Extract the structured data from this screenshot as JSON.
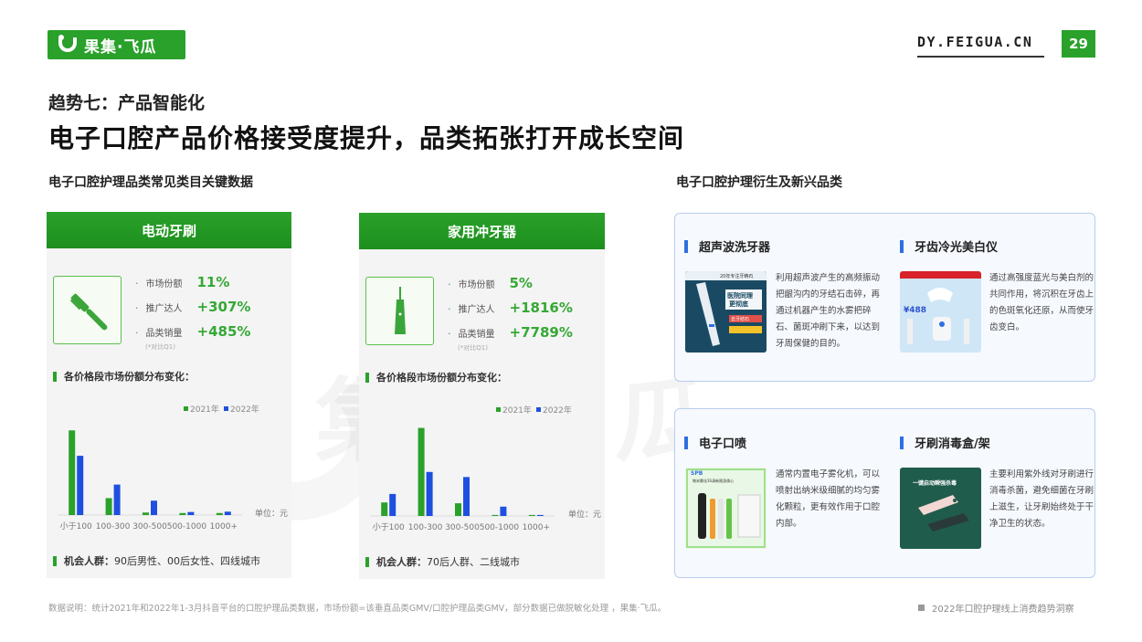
{
  "header": {
    "brand": "果集·飞瓜",
    "site": "DY.FEIGUA.CN",
    "page_number": "29"
  },
  "kicker": "趋势七：产品智能化",
  "headline": "电子口腔产品价格接受度提升，品类拓张打开成长空间",
  "left_section_title": "电子口腔护理品类常见类目关键数据",
  "right_section_title": "电子口腔护理衍生及新兴品类",
  "watermark": "果集·飞瓜",
  "cards": [
    {
      "title": "电动牙刷",
      "icon": "toothbrush-icon",
      "stats": [
        {
          "label": "市场份额",
          "value": "11%"
        },
        {
          "label": "推广达人",
          "value": "+307%"
        },
        {
          "label": "品类销量",
          "value": "+485%"
        }
      ],
      "note": "(*对比Q1)",
      "chart_title": "各价格段市场份额分布变化：",
      "crowd_label": "机会人群：",
      "crowd_value": "90后男性、00后女性、四线城市"
    },
    {
      "title": "家用冲牙器",
      "icon": "water-flosser-icon",
      "stats": [
        {
          "label": "市场份额",
          "value": "5%"
        },
        {
          "label": "推广达人",
          "value": "+1816%"
        },
        {
          "label": "品类销量",
          "value": "+7789%"
        }
      ],
      "note": "(*对比Q1)",
      "chart_title": "各价格段市场份额分布变化：",
      "crowd_label": "机会人群：",
      "crowd_value": "70后人群、二线城市"
    }
  ],
  "chart_data": [
    {
      "type": "bar",
      "categories": [
        "小于100",
        "100-300",
        "300-500",
        "500-1000",
        "1000+"
      ],
      "series": [
        {
          "name": "2021年",
          "values": [
            50,
            10,
            1.5,
            1.2,
            1.2
          ],
          "color": "#2aa12a"
        },
        {
          "name": "2022年",
          "values": [
            35,
            18,
            8.5,
            1.8,
            2.0
          ],
          "color": "#1f4fe0"
        }
      ],
      "unit_label": "单位：元",
      "ylim": [
        0,
        55
      ],
      "legend": "top-right"
    },
    {
      "type": "bar",
      "categories": [
        "小于100",
        "100-300",
        "300-500",
        "500-1000",
        "1000+"
      ],
      "series": [
        {
          "name": "2021年",
          "values": [
            8,
            52,
            7.5,
            0.6,
            0.6
          ],
          "color": "#2aa12a"
        },
        {
          "name": "2022年",
          "values": [
            13,
            26,
            23,
            5.5,
            0.6
          ],
          "color": "#1f4fe0"
        }
      ],
      "unit_label": "单位：元",
      "ylim": [
        0,
        55
      ],
      "legend": "top-right"
    }
  ],
  "new_categories": [
    {
      "title": "超声波洗牙器",
      "image": "ultrasonic-scaler-product-image",
      "image_text_1": "20年专注牙精石",
      "image_text_2": "医院同理",
      "image_text_3": "更彻底",
      "image_text_4": "去牙结石",
      "description": "利用超声波产生的高频振动把龈沟内的牙结石击碎，再通过机器产生的水雾把碎石、菌斑冲刷下来，以达到牙周保健的目的。"
    },
    {
      "title": "牙齿冷光美白仪",
      "image": "led-whitening-device-image",
      "image_text_1": "¥488",
      "description": "通过高强度蓝光与美白剂的共同作用，将沉积在牙齿上的色斑氧化还原，从而使牙齿变白。"
    },
    {
      "title": "电子口喷",
      "image": "oral-spray-product-image",
      "image_text_1": "SPB",
      "image_text_2": "物米雾化3S清新随身焕心",
      "description": "通常内置电子雾化机，可以喷射出纳米级细腻的均匀雾化颗粒，更有效作用于口腔内部。"
    },
    {
      "title": "牙刷消毒盒/架",
      "image": "toothbrush-sterilizer-image",
      "image_text_1": "一键启动瞬强杀毒",
      "description": "主要利用紫外线对牙刷进行消毒杀菌，避免细菌在牙刷上滋生，让牙刷始终处于干净卫生的状态。"
    }
  ],
  "footer": {
    "note": "数据说明：统计2021年和2022年1-3月抖音平台的口腔护理品类数据，市场份额=该垂直品类GMV/口腔护理品类GMV，部分数据已做脱敏化处理 ，果集·飞瓜。",
    "report": "2022年口腔护理线上消费趋势洞察"
  },
  "colors": {
    "brand_green": "#2aa12a",
    "series_blue": "#1f4fe0",
    "accent_blue": "#2f6fe0"
  }
}
